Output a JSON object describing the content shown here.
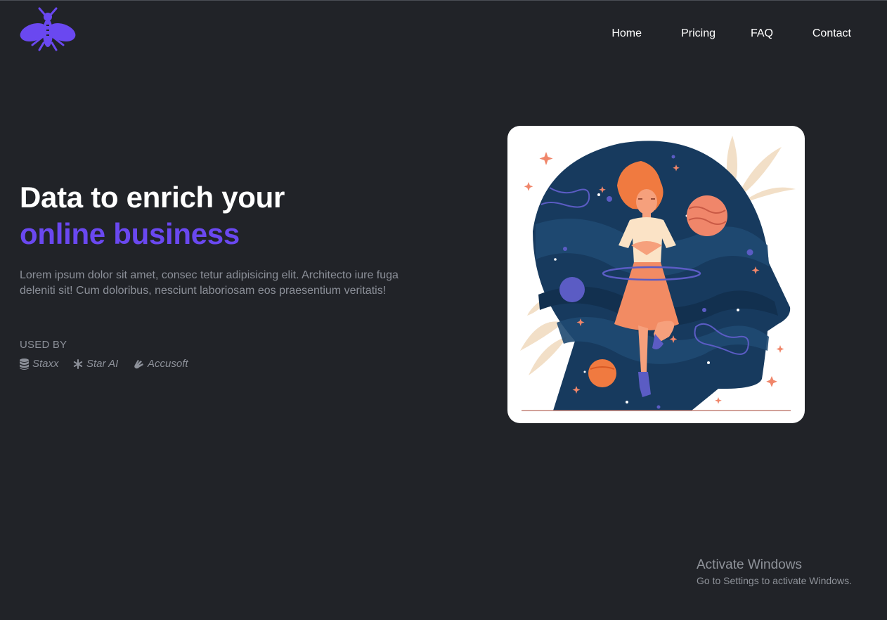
{
  "brand": {
    "logo_icon": "mosquito-logo-icon",
    "accent_color": "#6a48f0"
  },
  "nav": {
    "items": [
      {
        "label": "Home"
      },
      {
        "label": "Pricing"
      },
      {
        "label": "FAQ"
      },
      {
        "label": "Contact"
      }
    ]
  },
  "hero": {
    "title_line1": "Data to enrich your",
    "title_line2": "online business",
    "description": "Lorem ipsum dolor sit amet, consec tetur adipisicing elit. Architecto iure fuga deleniti sit! Cum doloribus, nesciunt laboriosam eos praesentium veritatis!",
    "used_by_label": "USED BY",
    "brands": [
      {
        "name": "Staxx",
        "icon": "database-icon"
      },
      {
        "name": "Star AI",
        "icon": "asterisk-icon"
      },
      {
        "name": "Accusoft",
        "icon": "sign-language-icon"
      }
    ],
    "illustration": "woman-meditating-in-head-illustration"
  },
  "os_overlay": {
    "title": "Activate Windows",
    "subtitle": "Go to Settings to activate Windows."
  },
  "colors": {
    "background": "#212328",
    "head_navy": "#173a5e",
    "planet_orange": "#f0866a",
    "figure_purple": "#5b5cc4"
  }
}
